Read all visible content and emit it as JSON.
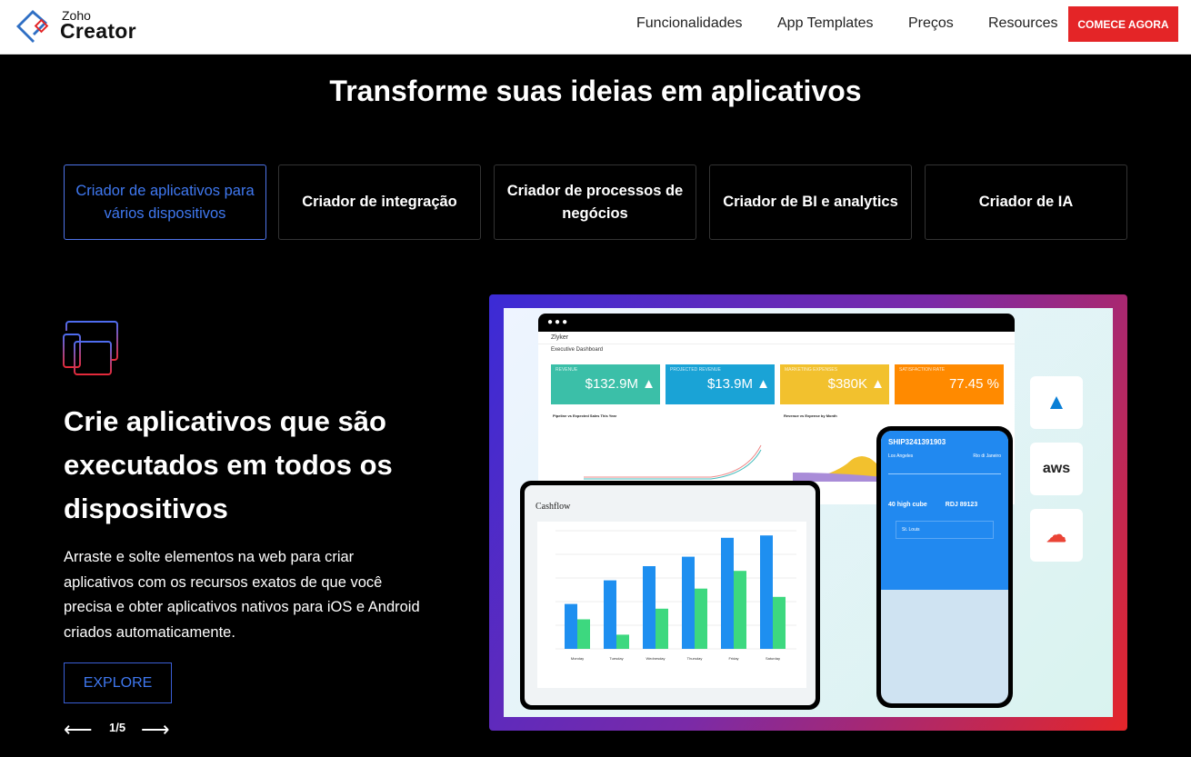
{
  "header": {
    "logo_top": "Zoho",
    "logo_main": "Creator",
    "nav": [
      "Funcionalidades",
      "App Templates",
      "Preços",
      "Resources"
    ],
    "cta": "COMECE AGORA"
  },
  "title": "Transforme suas ideias em aplicativos",
  "tabs": [
    {
      "label": "Criador de aplicativos para vários dispositivos",
      "active": true
    },
    {
      "label": "Criador de integração"
    },
    {
      "label": "Criador de processos de negócios"
    },
    {
      "label": "Criador de BI e analytics"
    },
    {
      "label": "Criador de IA"
    }
  ],
  "feature": {
    "icon": "multi-device-icon",
    "heading": "Crie aplicativos que são executados em todos os dispositivos",
    "description": "Arraste e solte elementos na web para criar aplicativos com os recursos exatos de que você precisa e obter aplicativos nativos para iOS e Android criados automaticamente.",
    "explore": "EXPLORE",
    "pager": "1/5"
  },
  "mockup": {
    "app": "Zlyker",
    "dashboard": "Executive Dashboard",
    "kpis": [
      {
        "label": "REVENUE",
        "value": "$132.9M ▲",
        "color": "#3bbfa8"
      },
      {
        "label": "PROJECTED REVENUE",
        "value": "$13.9M ▲",
        "color": "#1aa3d6"
      },
      {
        "label": "MARKETING EXPENSES",
        "value": "$380K ▲",
        "color": "#f2c12e"
      },
      {
        "label": "SATISFACTION RATE",
        "value": "77.45 %",
        "color": "#ff8a00"
      }
    ],
    "chart1": "Pipeline vs Expected Sales This Year",
    "chart2": "Revenue vs Expense by Month",
    "cashflow": {
      "title": "Cashflow",
      "days": [
        "Monday",
        "Tuesday",
        "Wednesday",
        "Thursday",
        "Friday",
        "Saturday"
      ],
      "blue": [
        0.38,
        0.58,
        0.7,
        0.78,
        0.94,
        0.96
      ],
      "green": [
        0.25,
        0.12,
        0.34,
        0.51,
        0.66,
        0.44
      ],
      "colors": [
        "#1e8ff0",
        "#3dd87f"
      ]
    },
    "ship": {
      "id": "SHIP3241391903",
      "from": "Los Angeles",
      "to": "Rio di Janeiro",
      "type": "40 high cube",
      "code": "RDJ 89123",
      "stop": "St. Louis"
    },
    "clouds": [
      "azure-icon",
      "aws",
      "google-cloud-icon"
    ]
  }
}
